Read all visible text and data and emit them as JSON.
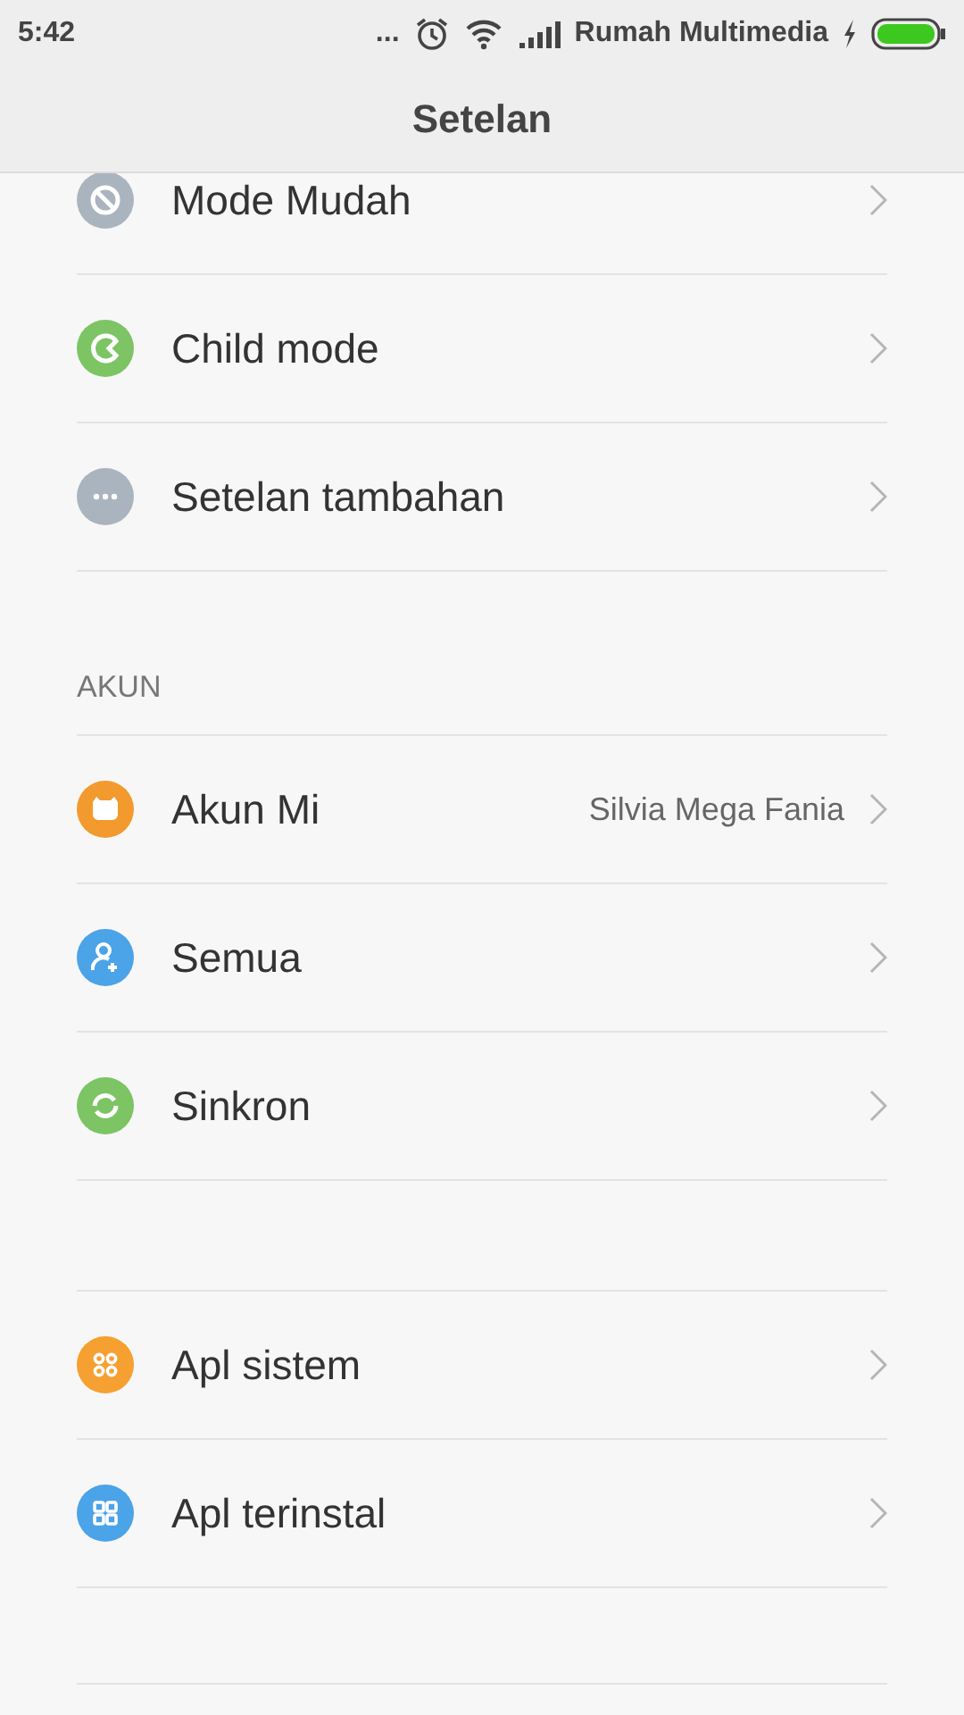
{
  "status_bar": {
    "time": "5:42",
    "more": "...",
    "carrier": "Rumah Multimedia"
  },
  "header": {
    "title": "Setelan"
  },
  "sections": [
    {
      "items": [
        {
          "kind": "easy",
          "label": "Mode Mudah",
          "color": "#aab4bf"
        },
        {
          "kind": "child",
          "label": "Child mode",
          "color": "#7cc464"
        },
        {
          "kind": "more",
          "label": "Setelan tambahan",
          "color": "#aab4bf"
        }
      ]
    },
    {
      "title": "AKUN",
      "items": [
        {
          "kind": "mi",
          "label": "Akun Mi",
          "value": "Silvia Mega Fania",
          "color": "#f39a2e"
        },
        {
          "kind": "user",
          "label": "Semua",
          "color": "#4ba3e8"
        },
        {
          "kind": "sync",
          "label": "Sinkron",
          "color": "#7cc464"
        }
      ]
    },
    {
      "items": [
        {
          "kind": "system",
          "label": "Apl sistem",
          "color": "#f5a030"
        },
        {
          "kind": "apps",
          "label": "Apl terinstal",
          "color": "#4ba3e8"
        }
      ]
    }
  ]
}
